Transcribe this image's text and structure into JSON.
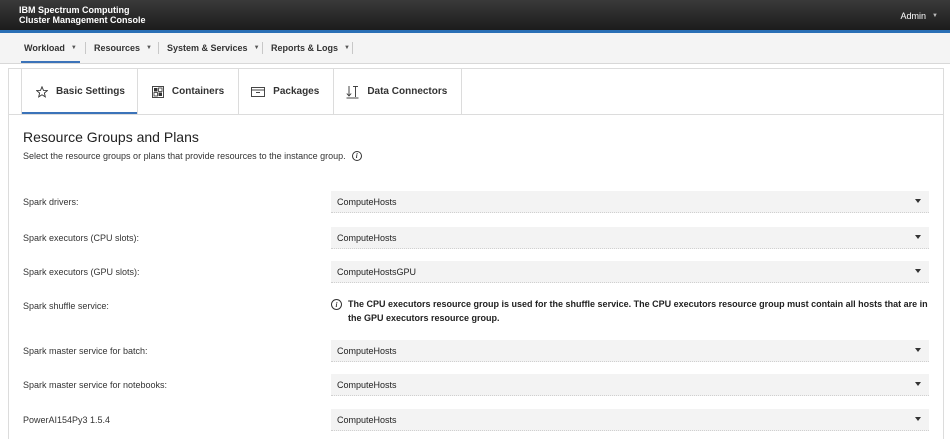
{
  "app": {
    "title_line1": "IBM Spectrum Computing",
    "title_line2": "Cluster Management Console",
    "user": "Admin"
  },
  "nav": {
    "items": [
      {
        "label": "Workload"
      },
      {
        "label": "Resources"
      },
      {
        "label": "System & Services"
      },
      {
        "label": "Reports & Logs"
      }
    ]
  },
  "tabs": [
    {
      "label": "Basic Settings",
      "icon": "star-icon"
    },
    {
      "label": "Containers",
      "icon": "containers-icon"
    },
    {
      "label": "Packages",
      "icon": "package-icon"
    },
    {
      "label": "Data Connectors",
      "icon": "data-connectors-icon"
    }
  ],
  "section": {
    "title": "Resource Groups and Plans",
    "description": "Select the resource groups or plans that provide resources to the instance group."
  },
  "rows": [
    {
      "label": "Spark drivers:",
      "value": "ComputeHosts"
    },
    {
      "label": "Spark executors (CPU slots):",
      "value": "ComputeHosts"
    },
    {
      "label": "Spark executors (GPU slots):",
      "value": "ComputeHostsGPU"
    },
    {
      "label": "Spark shuffle service:",
      "note": "The CPU executors resource group is used for the shuffle service. The CPU executors resource group must contain all hosts that are in the GPU executors resource group."
    },
    {
      "label": "Spark master service for batch:",
      "value": "ComputeHosts"
    },
    {
      "label": "Spark master service for notebooks:",
      "value": "ComputeHosts"
    },
    {
      "label": "PowerAI154Py3 1.5.4",
      "value": "ComputeHosts"
    }
  ],
  "colors": {
    "accent": "#3b73b9",
    "banner": "#1c1c1c",
    "select_bg": "#f3f3f3"
  }
}
